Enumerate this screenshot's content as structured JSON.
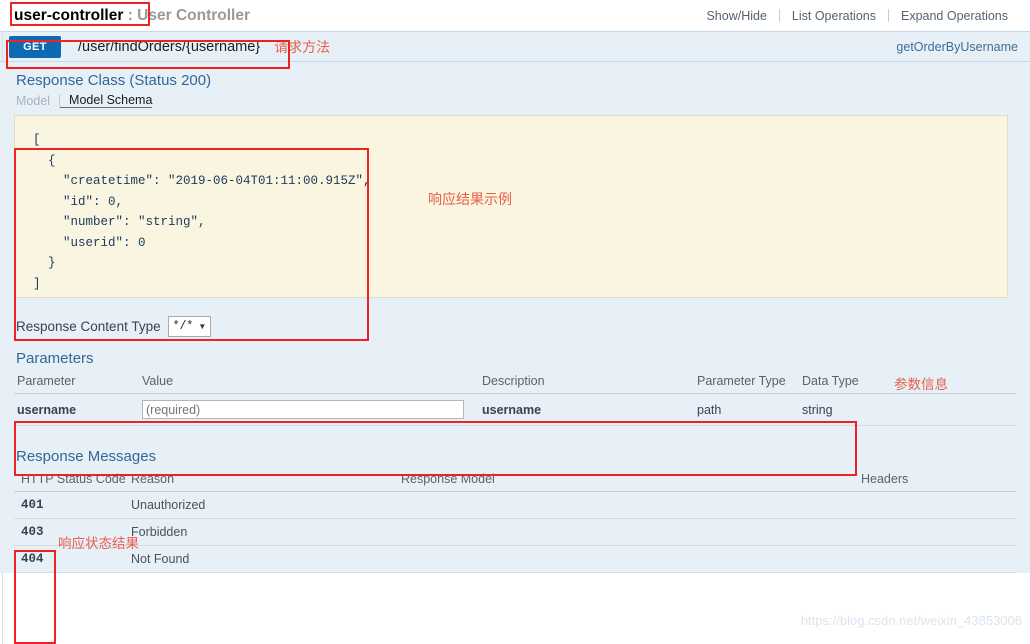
{
  "resource": {
    "name": "user-controller",
    "separator": " : ",
    "description": "User Controller",
    "actions": [
      {
        "label": "Show/Hide"
      },
      {
        "label": "List Operations"
      },
      {
        "label": "Expand Operations"
      }
    ]
  },
  "operation": {
    "method": "GET",
    "path": "/user/findOrders/{username}",
    "nickname": "getOrderByUsername",
    "annotation_method": "请求方法"
  },
  "response_class": {
    "title": "Response Class (Status 200)",
    "tabs": [
      {
        "label": "Model",
        "active": false
      },
      {
        "label": "Model Schema",
        "active": true
      }
    ],
    "schema_example": "[\n  {\n    \"createtime\": \"2019-06-04T01:11:00.915Z\",\n    \"id\": 0,\n    \"number\": \"string\",\n    \"userid\": 0\n  }\n]",
    "annotation_example": "响应结果示例"
  },
  "content_type": {
    "label": "Response Content Type",
    "value": "*/*",
    "caret": "chevron-down-icon"
  },
  "parameters": {
    "title": "Parameters",
    "headers": [
      "Parameter",
      "Value",
      "Description",
      "Parameter Type",
      "Data Type"
    ],
    "rows": [
      {
        "parameter": "username",
        "value_placeholder": "(required)",
        "value": "",
        "description": "username",
        "parameter_type": "path",
        "data_type": "string"
      }
    ],
    "annotation": "参数信息"
  },
  "response_messages": {
    "title": "Response Messages",
    "headers": [
      "HTTP Status Code",
      "Reason",
      "Response Model",
      "Headers"
    ],
    "rows": [
      {
        "code": "401",
        "reason": "Unauthorized",
        "model": "",
        "headers": ""
      },
      {
        "code": "403",
        "reason": "Forbidden",
        "model": "",
        "headers": ""
      },
      {
        "code": "404",
        "reason": "Not Found",
        "model": "",
        "headers": ""
      }
    ],
    "annotation": "响应状态结果"
  },
  "watermark": "https://blog.csdn.net/weixin_43853006",
  "colors": {
    "method_get": "#0f6ab4",
    "operation_bg": "#e7f0f7",
    "code_bg": "#faf5e0",
    "annotation_red": "#e8604c",
    "box_red": "#ee2222",
    "heading_blue": "#336699"
  }
}
